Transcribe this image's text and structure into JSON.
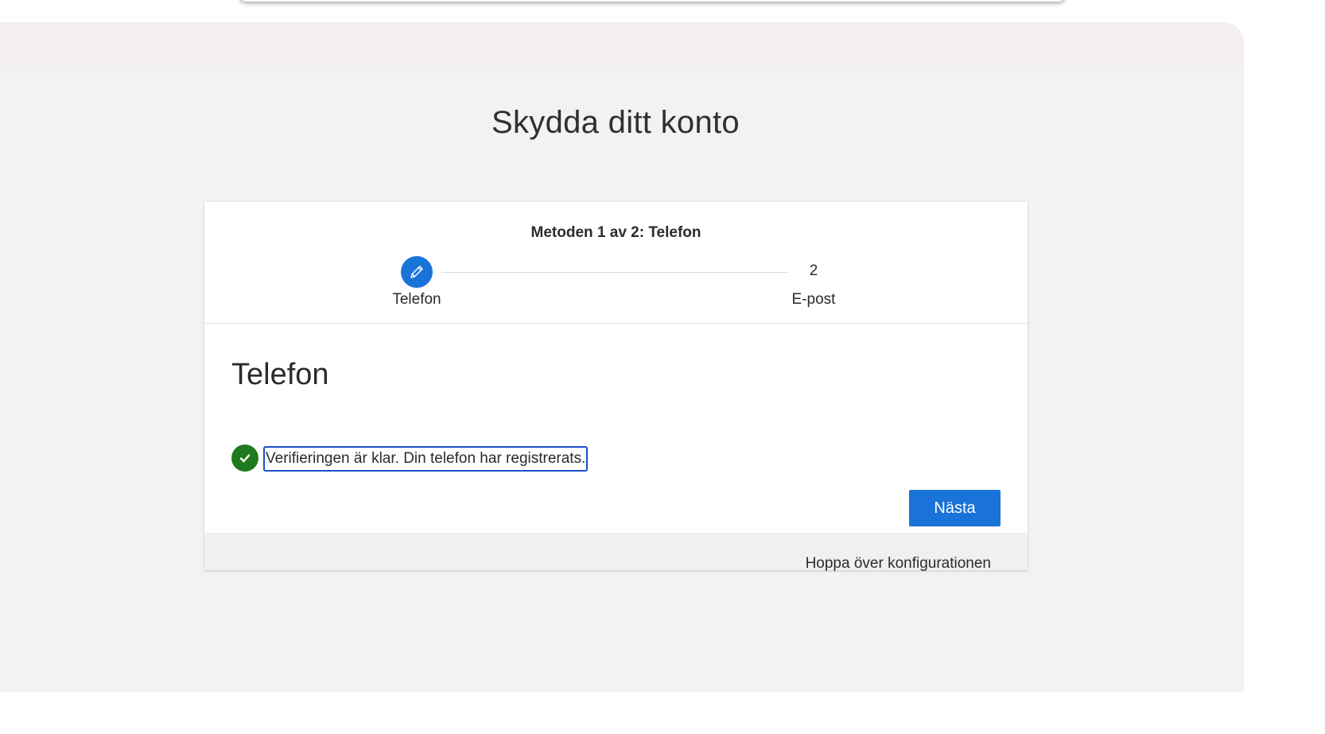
{
  "page": {
    "title": "Skydda ditt konto"
  },
  "progress": {
    "heading": "Metoden 1 av 2: Telefon",
    "current_step": 1,
    "total_steps": 2,
    "steps": [
      {
        "number": "1",
        "label": "Telefon",
        "state": "active",
        "icon": "pencil-icon"
      },
      {
        "number": "2",
        "label": "E-post",
        "state": "pending"
      }
    ]
  },
  "section": {
    "title": "Telefon",
    "status_icon": "check-circle-icon",
    "status_message": "Verifieringen är klar. Din telefon har registrerats."
  },
  "actions": {
    "next_label": "Nästa",
    "skip_label": "Hoppa över konfigurationen"
  },
  "colors": {
    "accent": "#1a73d9",
    "success": "#1e7a1e",
    "focus_outline": "#1a4fc8"
  }
}
